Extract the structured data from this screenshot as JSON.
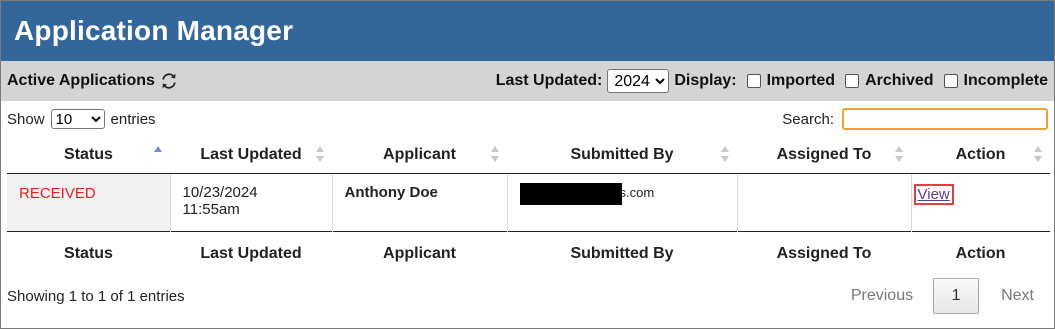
{
  "header": {
    "title": "Application Manager"
  },
  "toolbar": {
    "active_label": "Active Applications",
    "last_updated_label": "Last Updated:",
    "year_value": "2024",
    "display_label": "Display:",
    "filters": {
      "imported": "Imported",
      "archived": "Archived",
      "incomplete": "Incomplete"
    }
  },
  "controls": {
    "show_label": "Show",
    "entries_value": "10",
    "entries_label": "entries",
    "search_label": "Search:"
  },
  "table": {
    "columns": [
      "Status",
      "Last Updated",
      "Applicant",
      "Submitted By",
      "Assigned To",
      "Action"
    ],
    "rows": [
      {
        "status": "RECEIVED",
        "date": "10/23/2024",
        "time": "11:55am",
        "applicant": "Anthony Doe",
        "submitted_suffix": "s.com",
        "assigned_to": "",
        "action": "View"
      }
    ]
  },
  "footer": {
    "info": "Showing 1 to 1 of 1 entries",
    "previous": "Previous",
    "page": "1",
    "next": "Next"
  },
  "colors": {
    "header_bg": "#336699",
    "toolbar_bg": "#d4d4d4",
    "status_red": "#e02020",
    "search_border": "#e8a330",
    "view_highlight": "#e04040"
  }
}
